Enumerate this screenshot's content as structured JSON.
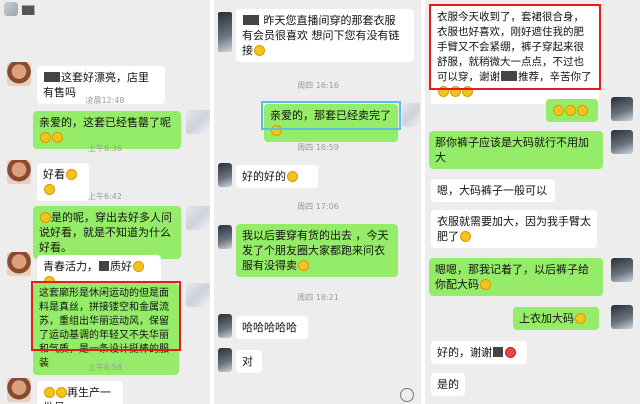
{
  "panel1": {
    "header": "██",
    "msgs": [
      {
        "text": "这套好漂亮，店里有售吗"
      },
      {
        "text": "凌晨12:48"
      },
      {
        "text": "亲爱的，这套已经售罄了呢"
      },
      {
        "text": "上午6:36"
      },
      {
        "text": "好看"
      },
      {
        "text": "上午6:42"
      },
      {
        "text": "是的呢，穿出去好多人问说好看，就是不知道为什么好看。"
      },
      {
        "text": "青春活力，"
      },
      {
        "text": "质好"
      },
      {
        "text": "这套廓形是休闲运动的但是面料是真丝，拼接镂空和金属流苏，重组出华丽运动风，保留了运动基调的年轻又不失华丽和气质，是一条设计挺棒的服装"
      },
      {
        "text": "上午6:58"
      },
      {
        "text": "再生产一批贝"
      }
    ]
  },
  "panel2": {
    "msgs": [
      {
        "text": "昨天您直播间穿的那套衣服 有会员很喜欢 想问下您有没有链接"
      },
      {
        "text": "周四 16:16"
      },
      {
        "text": "亲爱的，那套已经卖完了"
      },
      {
        "text": "周四 16:59"
      },
      {
        "text": "好的好的"
      },
      {
        "text": "周四 17:06"
      },
      {
        "text": "我以后要穿有货的出去 ，今天发了个朋友圈大家都跑来问衣服有没得卖"
      },
      {
        "text": "周四 18:21"
      },
      {
        "text": "哈哈哈哈哈"
      },
      {
        "text": "对"
      }
    ]
  },
  "panel3": {
    "msgs": [
      {
        "text": "衣服今天收到了，套裙很合身，衣服也好喜欢，刚好遮住我的肥手臂又不会紧绷，裤子穿起来很舒服，就稍微大一点点，不过也可以穿，谢谢"
      },
      {
        "text": "推荐，辛苦你了"
      },
      {
        "text": "那你裤子应该是大码就行不用加大"
      },
      {
        "text": "嗯，大码裤子一般可以"
      },
      {
        "text": "衣服就需要加大，因为我手臂太肥了"
      },
      {
        "text": "嗯嗯，那我记着了，以后裤子给你配大码"
      },
      {
        "text": "上衣加大码"
      },
      {
        "text": "好的，谢谢"
      },
      {
        "text": "是的"
      }
    ]
  }
}
